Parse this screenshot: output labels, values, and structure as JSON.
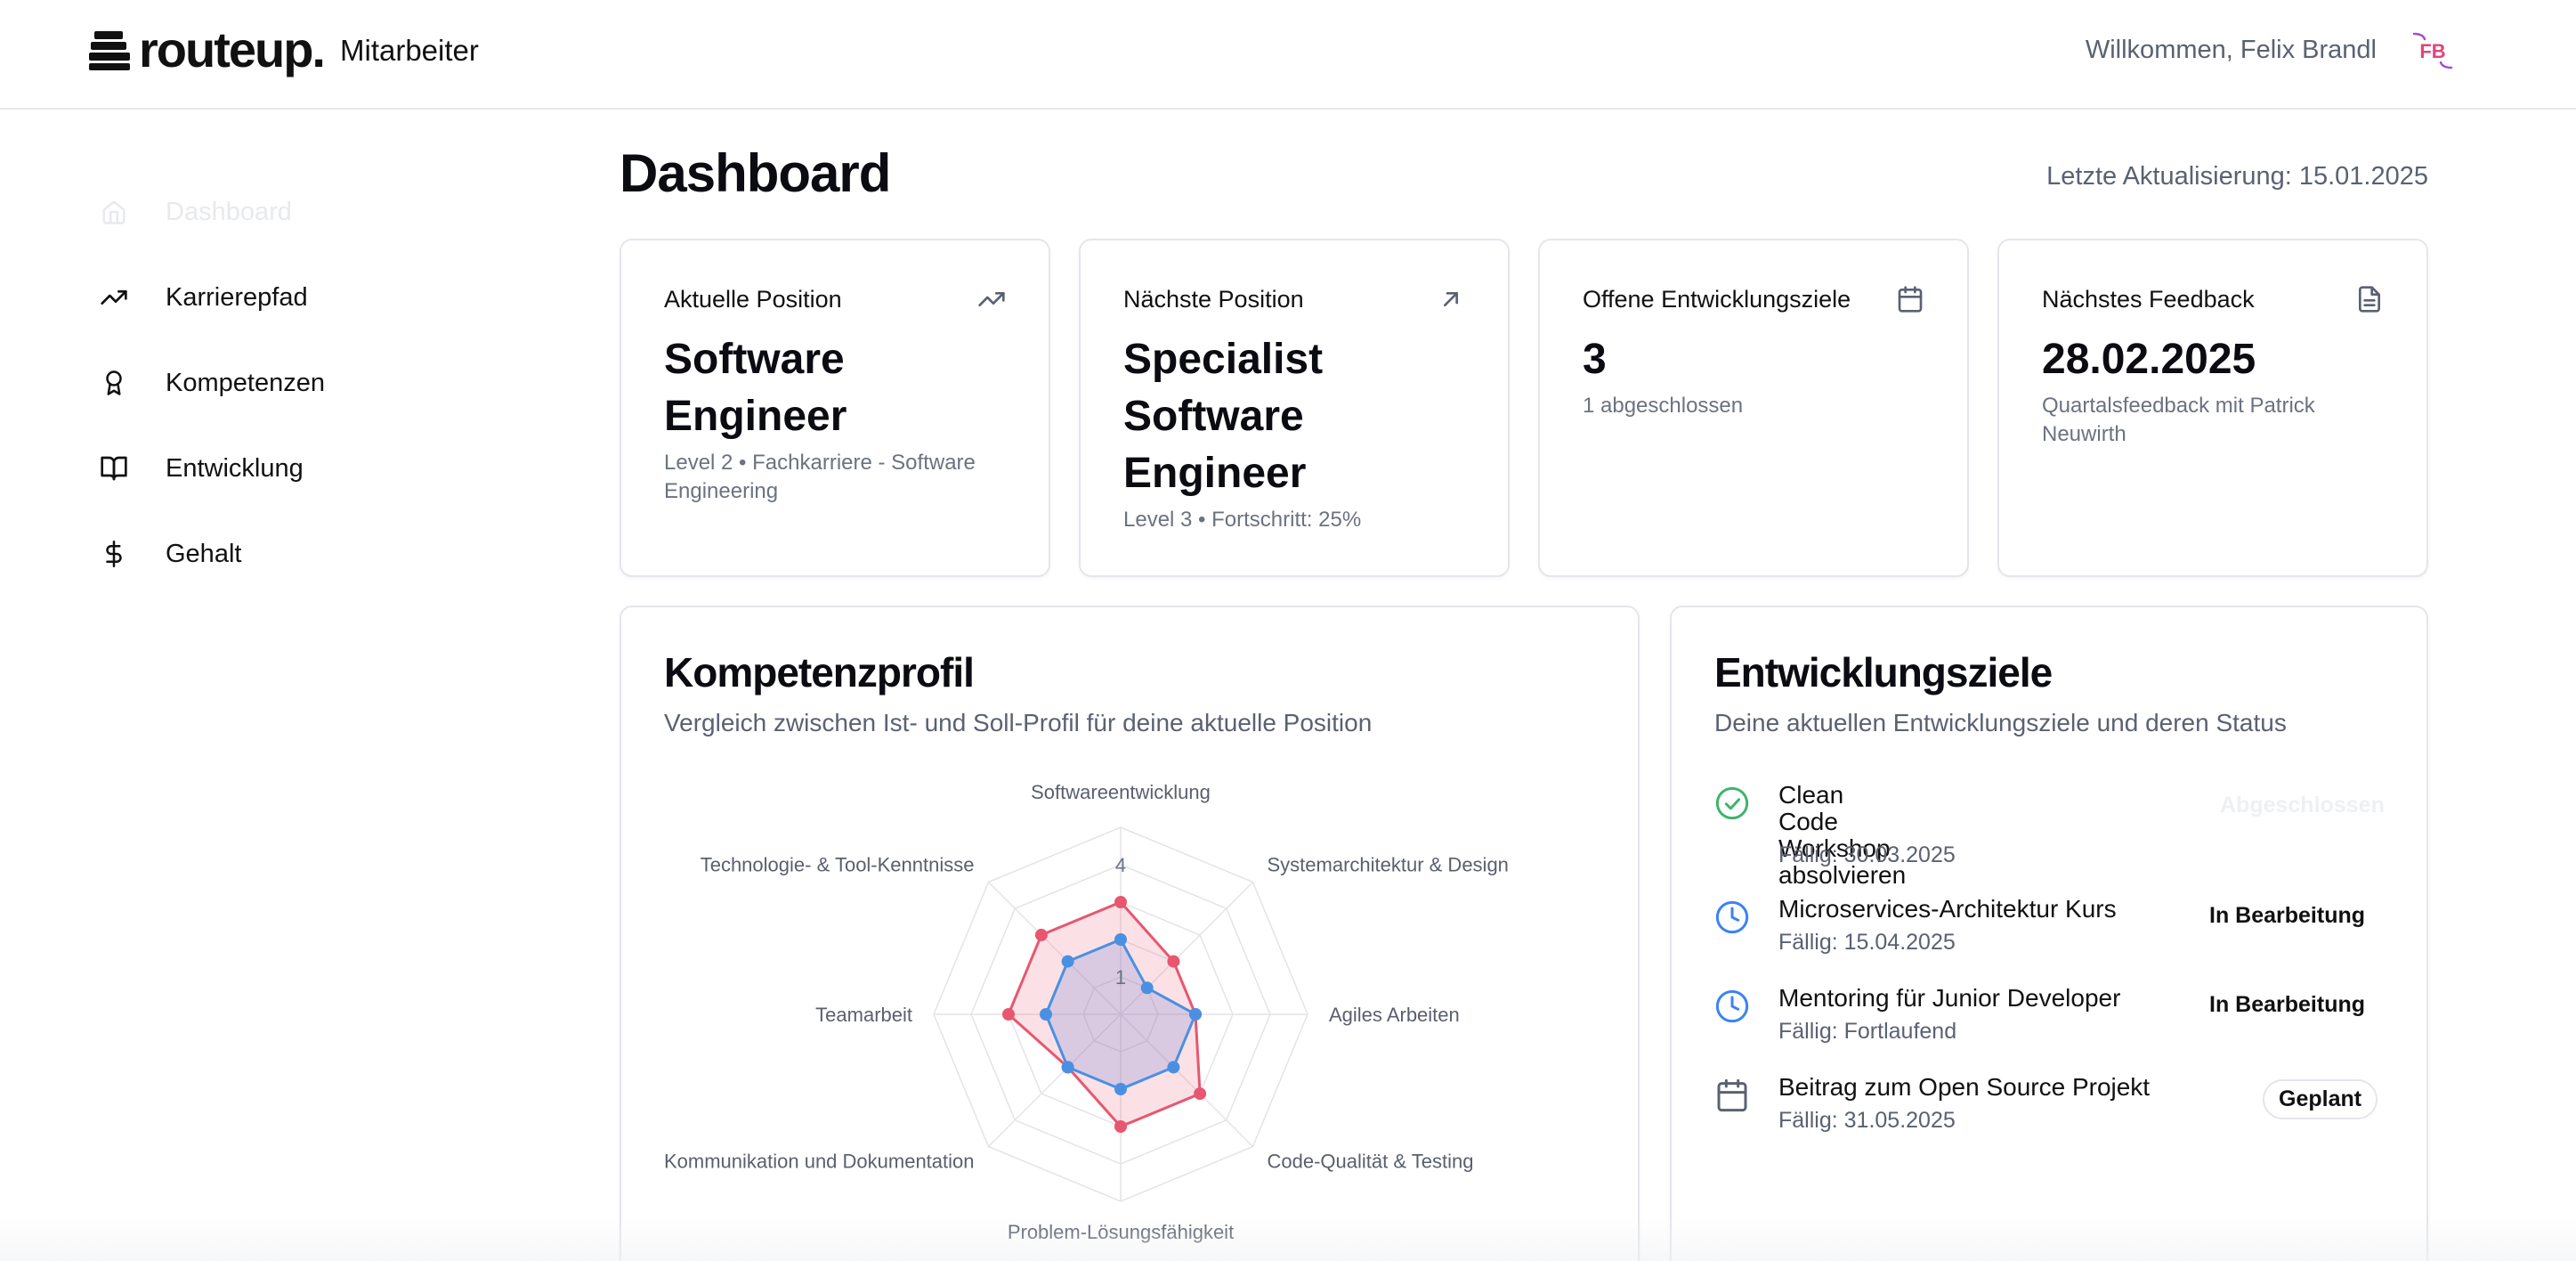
{
  "header": {
    "logo_text": "routeup.",
    "app_label": "Mitarbeiter",
    "welcome": "Willkommen, Felix Brandl",
    "avatar_initials": "FB",
    "avatar_color": "#e0457b"
  },
  "sidebar": {
    "items": [
      {
        "label": "Dashboard",
        "icon": "home-icon",
        "active": true
      },
      {
        "label": "Karrierepfad",
        "icon": "trending-up-icon"
      },
      {
        "label": "Kompetenzen",
        "icon": "award-icon"
      },
      {
        "label": "Entwicklung",
        "icon": "book-open-icon"
      },
      {
        "label": "Gehalt",
        "icon": "dollar-icon"
      }
    ]
  },
  "page": {
    "title": "Dashboard",
    "last_update": "Letzte Aktualisierung: 15.01.2025"
  },
  "stats": [
    {
      "label": "Aktuelle Position",
      "value_lines": [
        "Software",
        "Engineer"
      ],
      "sub": "Level 2 • Fachkarriere - Software Engineering",
      "icon": "trending-up-icon"
    },
    {
      "label": "Nächste Position",
      "value_lines": [
        "Specialist",
        "Software",
        "Engineer"
      ],
      "sub": "Level 3 • Fortschritt: 25%",
      "icon": "arrow-up-right-icon"
    },
    {
      "label": "Offene Entwicklungsziele",
      "value_lines": [
        "3"
      ],
      "sub": "1 abgeschlossen",
      "icon": "calendar-icon"
    },
    {
      "label": "Nächstes Feedback",
      "value_lines": [
        "28.02.2025"
      ],
      "sub": "Quartalsfeedback mit Patrick Neuwirth",
      "icon": "file-text-icon"
    }
  ],
  "competence": {
    "title": "Kompetenzprofil",
    "subtitle": "Vergleich zwischen Ist- und Soll-Profil für deine aktuelle Position"
  },
  "chart_data": {
    "type": "radar",
    "categories": [
      "Softwareentwicklung",
      "Systemarchitektur & Design",
      "Agiles Arbeiten",
      "Code-Qualität & Testing",
      "Problem-Lösungsfähigkeit",
      "Kommunikation und Dokumentation",
      "Teamarbeit",
      "Technologie- & Tool-Kenntnisse"
    ],
    "series": [
      {
        "values": [
          3,
          2,
          2,
          3,
          3,
          2,
          3,
          3
        ],
        "color": "#e8566f"
      },
      {
        "values": [
          2,
          1,
          2,
          2,
          2,
          2,
          2,
          2
        ],
        "color": "#4a90e2"
      }
    ],
    "rlim": [
      0,
      5
    ],
    "ticks_shown": [
      {
        "value": 1,
        "label": "1"
      },
      {
        "value": 4,
        "label": "4"
      }
    ],
    "grid": true
  },
  "goals": {
    "title": "Entwicklungsziele",
    "subtitle": "Deine aktuellen Entwicklungsziele und deren Status",
    "items": [
      {
        "title_lines": [
          "Clean Code Workshop",
          "absolvieren"
        ],
        "due": "Fällig: 30.03.2025",
        "status": "Abgeschlossen",
        "icon": "check-circle-icon"
      },
      {
        "title_lines": [
          "Microservices-Architektur Kurs"
        ],
        "due": "Fällig: 15.04.2025",
        "status": "In Bearbeitung",
        "icon": "clock-icon"
      },
      {
        "title_lines": [
          "Mentoring für Junior Developer"
        ],
        "due": "Fällig: Fortlaufend",
        "status": "In Bearbeitung",
        "icon": "clock-icon"
      },
      {
        "title_lines": [
          "Beitrag zum Open Source Projekt"
        ],
        "due": "Fällig: 31.05.2025",
        "status": "Geplant",
        "icon": "calendar-icon"
      }
    ]
  }
}
